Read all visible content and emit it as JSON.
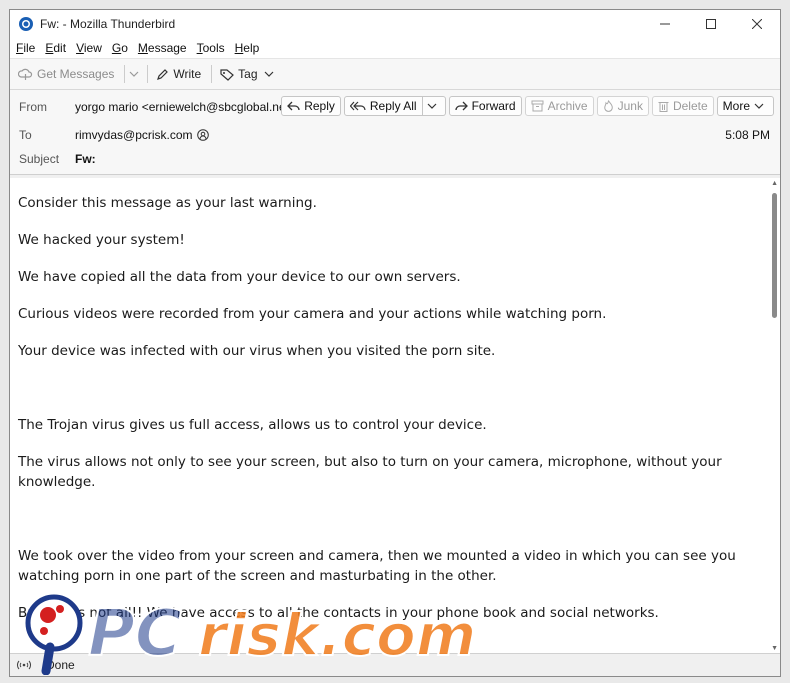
{
  "window": {
    "title": "Fw: - Mozilla Thunderbird"
  },
  "menu": [
    {
      "label": "File",
      "accel": "F",
      "rest": "ile"
    },
    {
      "label": "Edit",
      "accel": "E",
      "rest": "dit"
    },
    {
      "label": "View",
      "accel": "V",
      "rest": "iew"
    },
    {
      "label": "Go",
      "accel": "G",
      "rest": "o"
    },
    {
      "label": "Message",
      "accel": "M",
      "rest": "essage"
    },
    {
      "label": "Tools",
      "accel": "T",
      "rest": "ools"
    },
    {
      "label": "Help",
      "accel": "H",
      "rest": "elp"
    }
  ],
  "toolbar": {
    "get_messages": "Get Messages",
    "write": "Write",
    "tag": "Tag"
  },
  "header": {
    "from_label": "From",
    "from_value": "yorgo mario <erniewelch@sbcglobal.net>",
    "to_label": "To",
    "to_value": "rimvydas@pcrisk.com",
    "subject_label": "Subject",
    "subject_value": "Fw:",
    "time": "5:08 PM",
    "buttons": {
      "reply": "Reply",
      "reply_all": "Reply All",
      "forward": "Forward",
      "archive": "Archive",
      "junk": "Junk",
      "delete": "Delete",
      "more": "More"
    }
  },
  "body": [
    "Consider this message as your last warning.",
    "We hacked your system!",
    "We have copied all the data from your device to our own servers.",
    "Curious videos were recorded from your camera and your actions while watching porn.",
    "Your device was infected with our virus when you visited the porn site.",
    "The Trojan virus gives us full access, allows us to control your device.",
    "The virus allows not only to see your screen, but also to turn on your camera, microphone, without your knowledge.",
    "We took over the video from your screen and camera, then we mounted a video in which you can see you watching porn in one part of the screen and masturbating in the other.",
    "But this is not all!! We have access to all the contacts in your phone book and social networks."
  ],
  "status": {
    "text": "Done"
  },
  "watermark": {
    "text": "PCrisk.com"
  },
  "colors": {
    "accent": "#1a5fb4",
    "watermark_orange": "#f07a1a",
    "watermark_blue": "#1e3a8a",
    "watermark_red": "#d42020"
  }
}
